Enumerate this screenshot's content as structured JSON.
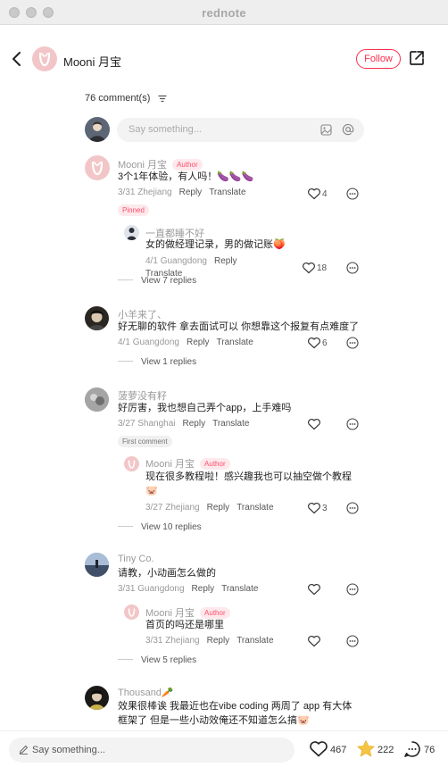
{
  "window": {
    "title": "rednote"
  },
  "header": {
    "author_name": "Mooni 月宝",
    "follow_label": "Follow"
  },
  "comments_header": {
    "count_label": "76 comment(s)"
  },
  "composer": {
    "placeholder": "Say something..."
  },
  "author_tag": "Author",
  "comments": [
    {
      "name": "Mooni 月宝",
      "text": "3个1年体验，有人吗！🍆🍆🍆",
      "date": "3/31",
      "location": "Zhejiang",
      "likes": "4",
      "badge": "Pinned",
      "reply": {
        "name": "一直都睡不好",
        "text": "女的做经理记录，男的做记账🍑",
        "date": "4/1",
        "location": "Guangdong",
        "likes": "18"
      },
      "view_replies": "View 7 replies"
    },
    {
      "name": "小羊来了、",
      "text": "好无聊的软件 拿去面试可以 你想靠这个报复有点难度了",
      "date": "4/1",
      "location": "Guangdong",
      "likes": "6",
      "view_replies": "View 1 replies"
    },
    {
      "name": "菠萝没有籽",
      "text": "好厉害，我也想自己弄个app，上手难吗",
      "date": "3/27",
      "location": "Shanghai",
      "badge": "First comment",
      "reply": {
        "name": "Mooni 月宝",
        "text_line1": "现在很多教程啦！感兴趣我也可以抽空做个教程",
        "text_line2": "🐷",
        "date": "3/27",
        "location": "Zhejiang",
        "likes": "3"
      },
      "view_replies": "View 10 replies"
    },
    {
      "name": "Tiny Co.",
      "text": "请教，小动画怎么做的",
      "date": "3/31",
      "location": "Guangdong",
      "reply": {
        "name": "Mooni 月宝",
        "text": "首页的吗还是哪里",
        "date": "3/31",
        "location": "Zhejiang"
      },
      "view_replies": "View 5 replies"
    },
    {
      "name": "Thousand🥕",
      "text_line1": "效果很棒诶 我最近也在vibe coding  两周了 app 有大体",
      "text_line2": "框架了 但是一些小动效俺还不知道怎么搞🐷"
    }
  ],
  "actions": {
    "reply": "Reply",
    "translate": "Translate"
  },
  "bottom_bar": {
    "placeholder": "Say something...",
    "likes": "467",
    "collects": "222",
    "comments": "76"
  },
  "colors": {
    "accent": "#ff2e4d",
    "brand_avatar": "#f2c6c8",
    "star": "#f5c542"
  },
  "icons": [
    "back-icon",
    "share-icon",
    "sort-icon",
    "image-icon",
    "at-icon",
    "heart-icon",
    "more-icon",
    "pen-icon",
    "star-icon",
    "comment-icon"
  ]
}
